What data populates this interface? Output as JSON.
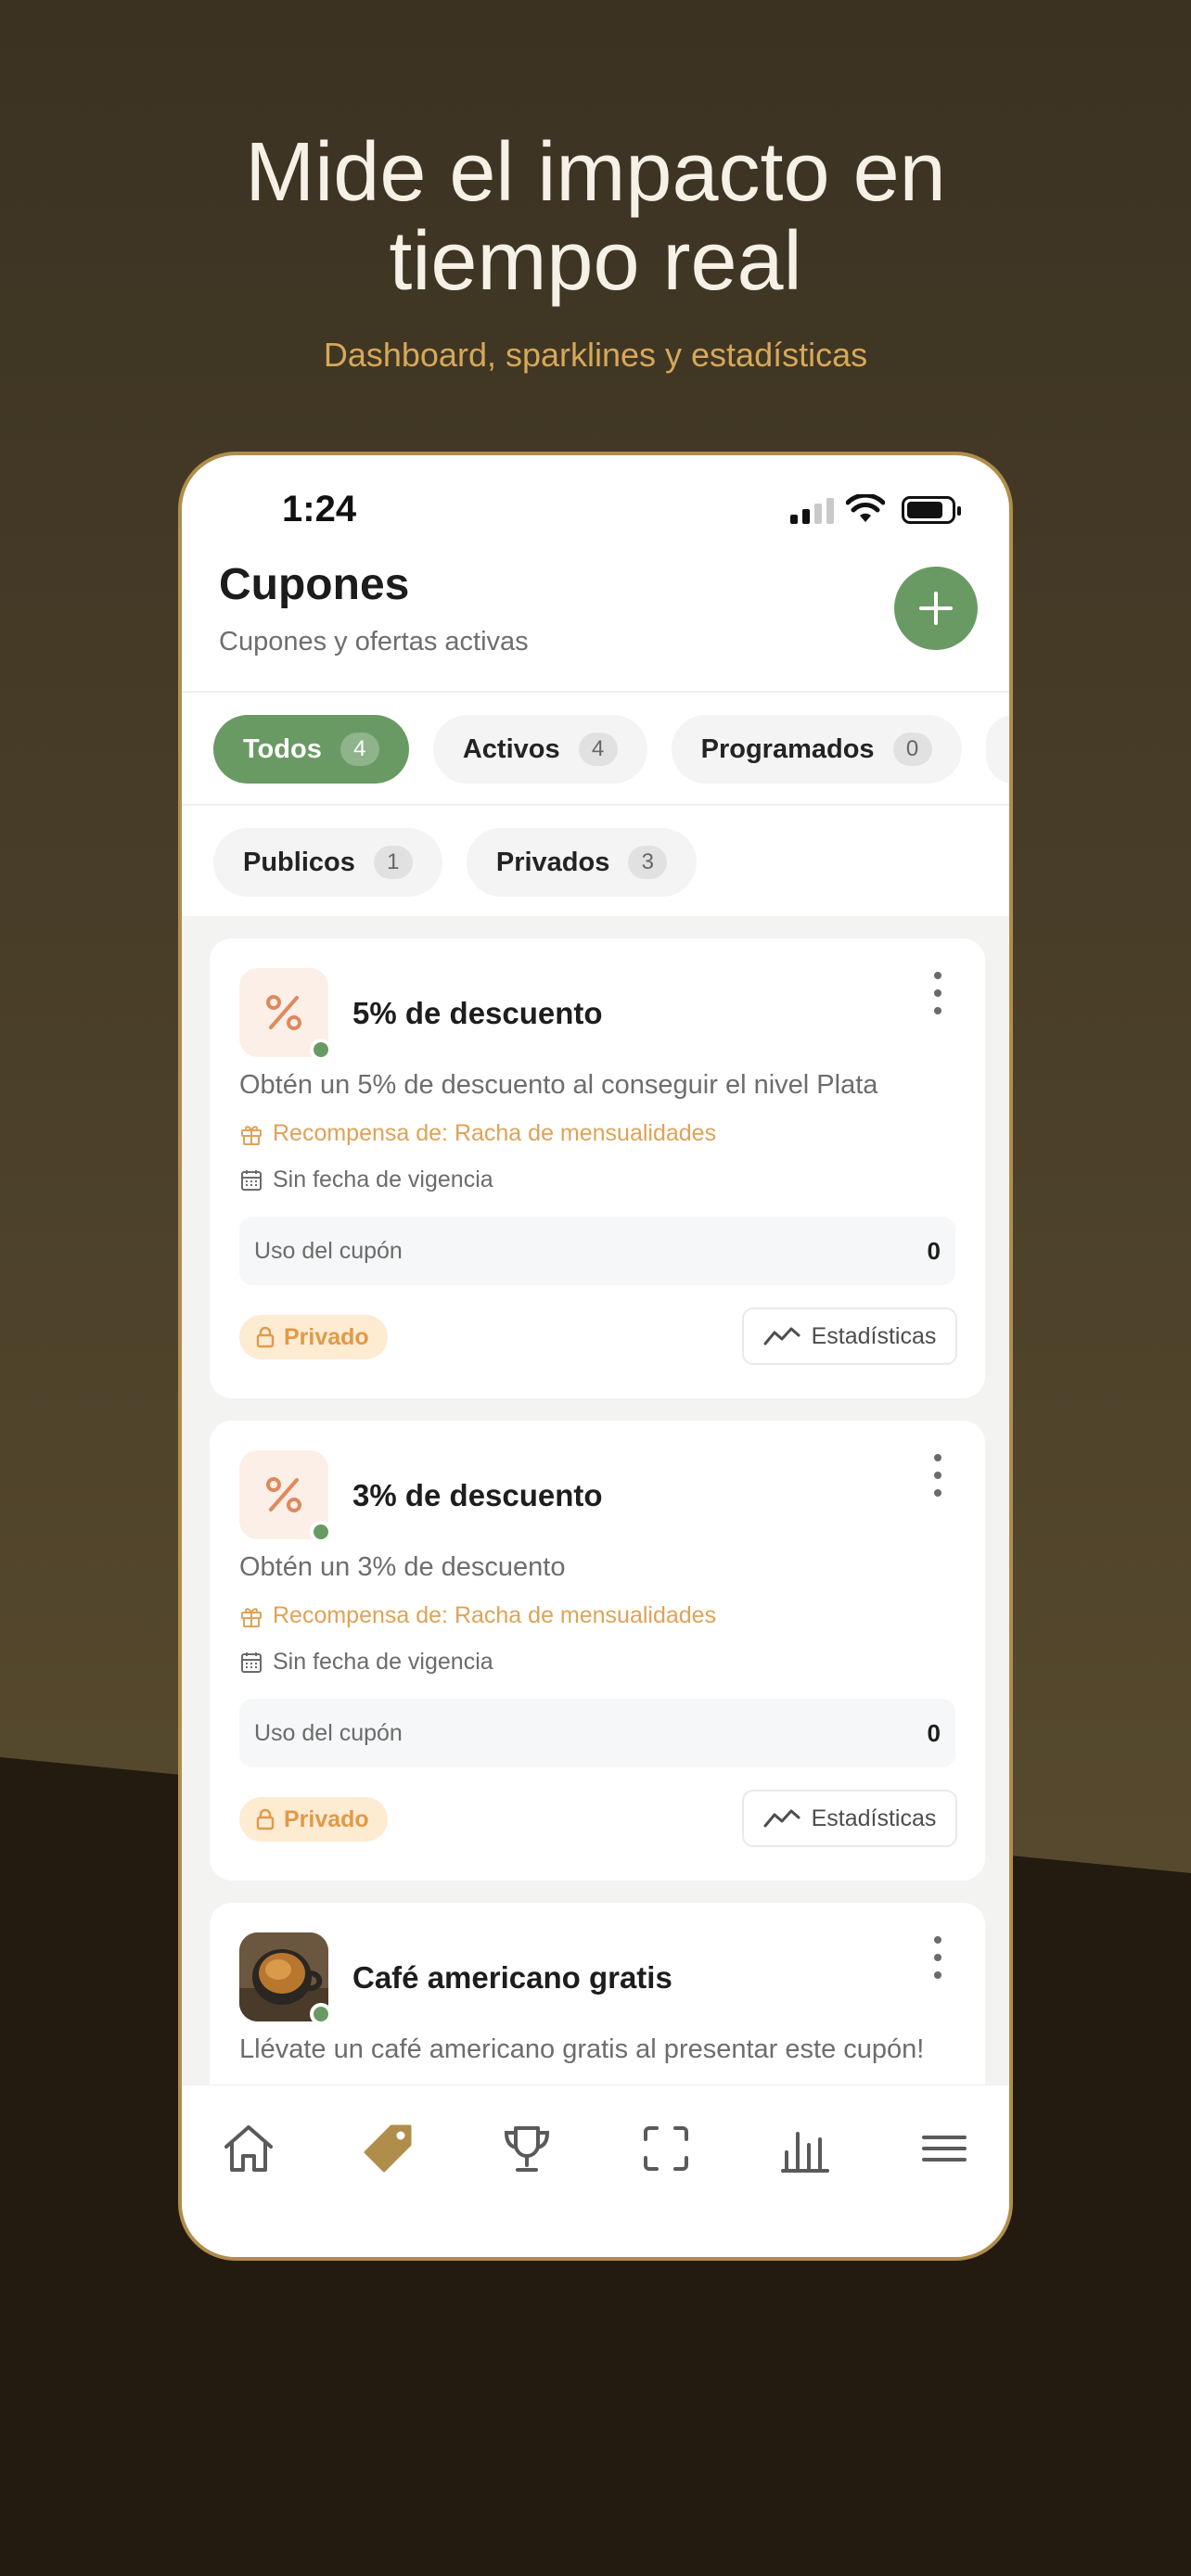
{
  "promo": {
    "headline_line1": "Mide el impacto en",
    "headline_line2": "tiempo real",
    "subheadline": "Dashboard, sparklines y estadísticas"
  },
  "status_bar": {
    "time": "1:24"
  },
  "header": {
    "title": "Cupones",
    "subtitle": "Cupones y ofertas activas",
    "add_button_icon": "plus-icon"
  },
  "filters_row1": [
    {
      "label": "Todos",
      "count": "4",
      "active": true
    },
    {
      "label": "Activos",
      "count": "4",
      "active": false
    },
    {
      "label": "Programados",
      "count": "0",
      "active": false
    }
  ],
  "filters_row2": [
    {
      "label": "Publicos",
      "count": "1",
      "active": false
    },
    {
      "label": "Privados",
      "count": "3",
      "active": false
    }
  ],
  "coupons": [
    {
      "title": "5% de descuento",
      "description": "Obtén un 5% de descuento al conseguir el nivel Plata",
      "reward": "Recompensa de: Racha de mensualidades",
      "validity": "Sin fecha de vigencia",
      "usage_label": "Uso del cupón",
      "usage_value": "0",
      "visibility": "Privado",
      "stats_label": "Estadísticas",
      "icon": "percent-icon"
    },
    {
      "title": "3% de descuento",
      "description": "Obtén un 3% de descuento",
      "reward": "Recompensa de: Racha de mensualidades",
      "validity": "Sin fecha de vigencia",
      "usage_label": "Uso del cupón",
      "usage_value": "0",
      "visibility": "Privado",
      "stats_label": "Estadísticas",
      "icon": "percent-icon"
    },
    {
      "title": "Café americano gratis",
      "description": "Llévate un café americano gratis al presentar este cupón!",
      "icon": "coffee-photo"
    }
  ],
  "tabbar": {
    "items": [
      "home-icon",
      "tag-icon",
      "trophy-icon",
      "scan-icon",
      "bar-chart-icon",
      "menu-icon"
    ],
    "active": "tag-icon"
  },
  "colors": {
    "background": "#3d3323",
    "accent_green": "#6a9a63",
    "accent_gold": "#d6a85a",
    "private_badge": "#fdebd2",
    "reward_text": "#e0a256"
  }
}
